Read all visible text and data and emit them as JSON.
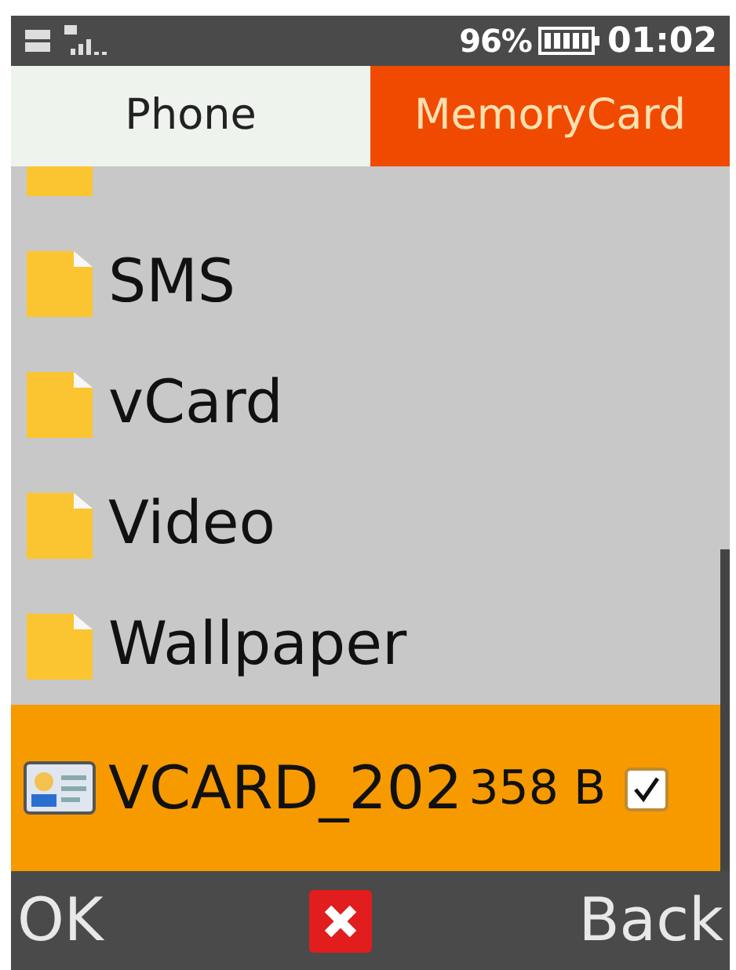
{
  "status_bar": {
    "battery_percent": "96%",
    "time": "01:02"
  },
  "tabs": [
    {
      "label": "Phone",
      "selected": false
    },
    {
      "label": "MemoryCard",
      "selected": true
    }
  ],
  "list": {
    "items": [
      {
        "kind": "folder",
        "selected": false
      },
      {
        "kind": "folder",
        "label": "SMS",
        "selected": false
      },
      {
        "kind": "folder",
        "label": "vCard",
        "selected": false
      },
      {
        "kind": "folder",
        "label": "Video",
        "selected": false
      },
      {
        "kind": "folder",
        "label": "Wallpaper",
        "selected": false
      },
      {
        "kind": "file",
        "label": "VCARD_202",
        "size": "358 B",
        "checked": true,
        "selected": true
      }
    ]
  },
  "softkeys": {
    "left": "OK",
    "right": "Back"
  }
}
